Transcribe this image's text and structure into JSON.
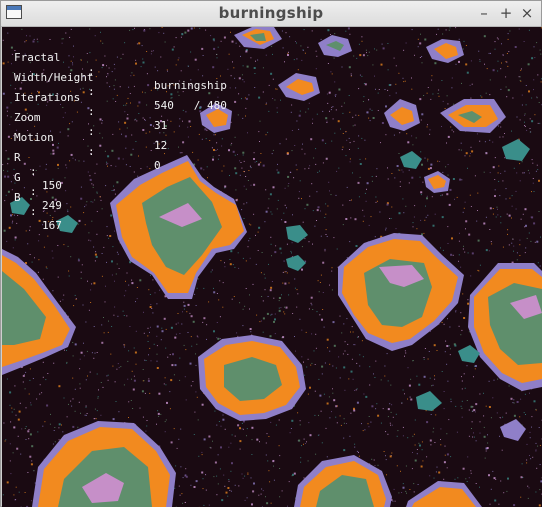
{
  "window": {
    "title": "burningship"
  },
  "controls": {
    "minimize": "–",
    "maximize": "+",
    "close": "×"
  },
  "info": {
    "fractal_label": "Fractal",
    "fractal_value": "burningship",
    "size_label": "Width/Height",
    "size_value": "540   / 480",
    "iterations_label": "Iterations",
    "iterations_value": "31",
    "zoom_label": "Zoom",
    "zoom_value": "12",
    "motion_label": "Motion",
    "motion_value": "0",
    "colon": ":"
  },
  "rgb": {
    "r_label": "R",
    "r_value": "150",
    "g_label": "G",
    "g_value": "249",
    "b_label": "B",
    "b_value": "167"
  },
  "colors": {
    "background": "#1a0a12",
    "orange": "#f28a1f",
    "green": "#5f8f6c",
    "violet": "#c68fc8",
    "purple": "#8f7fc8",
    "teal": "#3a8e8a"
  }
}
